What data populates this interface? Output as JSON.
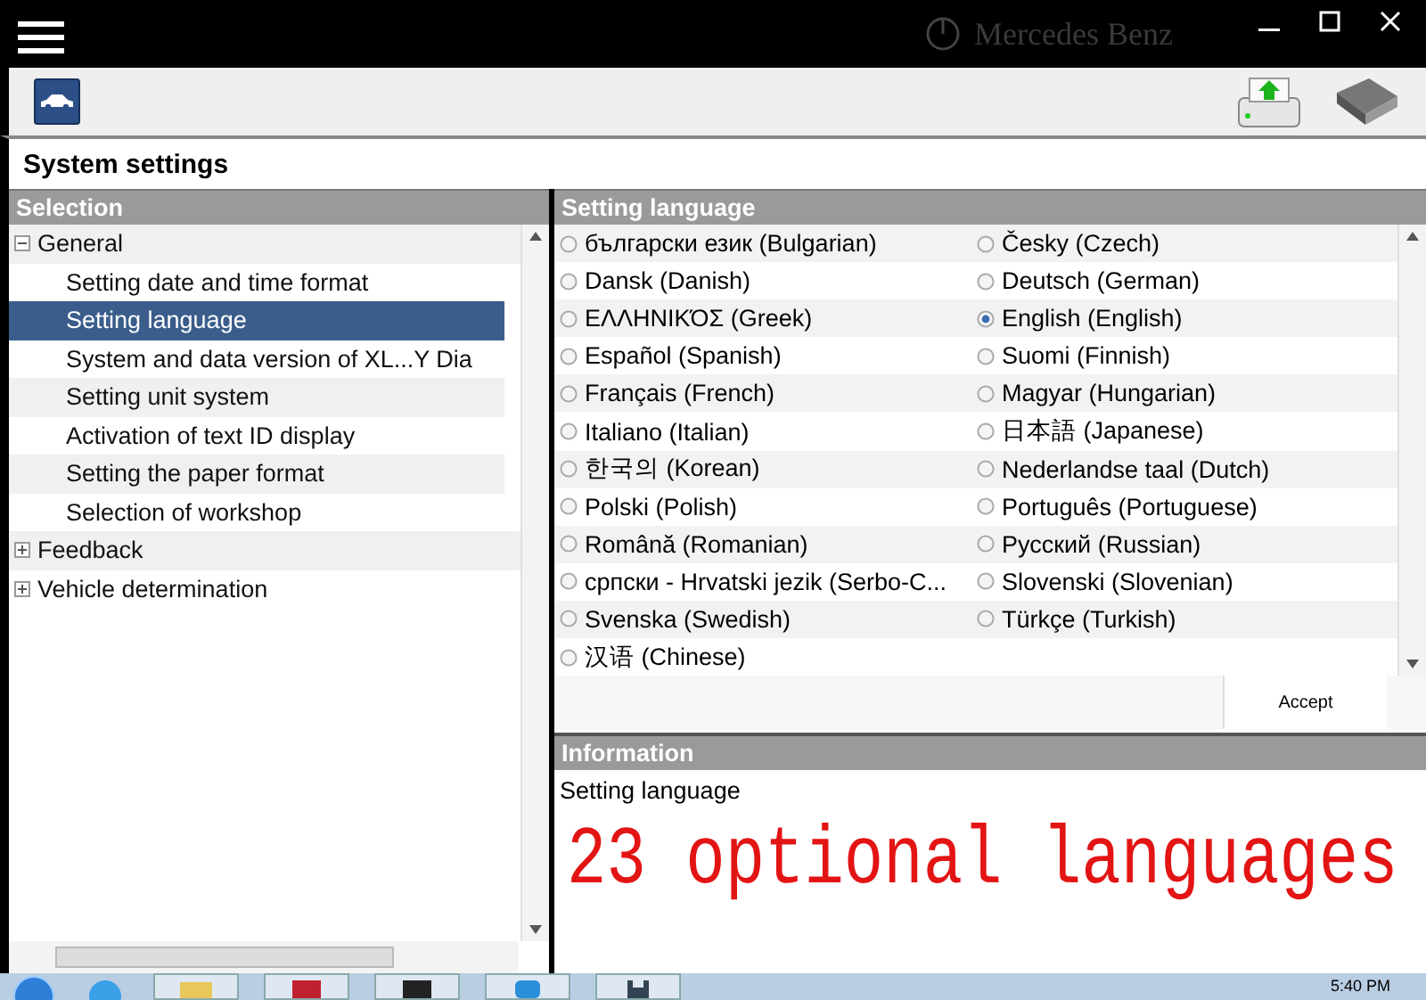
{
  "title_bar": {
    "brand": "Mercedes Benz"
  },
  "page_title": "System settings",
  "selection": {
    "header": "Selection",
    "tree": [
      {
        "label": "General",
        "expanded": true,
        "children": [
          {
            "label": "Setting date and time format",
            "selected": false
          },
          {
            "label": "Setting language",
            "selected": true
          },
          {
            "label": "System and data version of XL...Y Dia",
            "selected": false
          },
          {
            "label": "Setting unit system",
            "selected": false
          },
          {
            "label": "Activation of text ID display",
            "selected": false
          },
          {
            "label": "Setting the paper format",
            "selected": false
          },
          {
            "label": "Selection of workshop",
            "selected": false
          }
        ]
      },
      {
        "label": "Feedback",
        "expanded": false
      },
      {
        "label": "Vehicle determination",
        "expanded": false
      }
    ]
  },
  "language_panel": {
    "header": "Setting language",
    "languages": [
      {
        "label": "български език (Bulgarian)",
        "selected": false
      },
      {
        "label": "Dansk (Danish)",
        "selected": false
      },
      {
        "label": "ΕΛΛΗΝΙΚΌΣ (Greek)",
        "selected": false
      },
      {
        "label": "Español (Spanish)",
        "selected": false
      },
      {
        "label": "Français (French)",
        "selected": false
      },
      {
        "label": "Italiano (Italian)",
        "selected": false
      },
      {
        "label": "한국의 (Korean)",
        "selected": false
      },
      {
        "label": "Polski (Polish)",
        "selected": false
      },
      {
        "label": "Română (Romanian)",
        "selected": false
      },
      {
        "label": "српски - Hrvatski jezik (Serbo-C...",
        "selected": false
      },
      {
        "label": "Svenska (Swedish)",
        "selected": false
      },
      {
        "label": "汉语 (Chinese)",
        "selected": false
      },
      {
        "label": "Česky (Czech)",
        "selected": false
      },
      {
        "label": "Deutsch (German)",
        "selected": false
      },
      {
        "label": "English (English)",
        "selected": true
      },
      {
        "label": "Suomi (Finnish)",
        "selected": false
      },
      {
        "label": "Magyar (Hungarian)",
        "selected": false
      },
      {
        "label": "日本語 (Japanese)",
        "selected": false
      },
      {
        "label": "Nederlandse taal (Dutch)",
        "selected": false
      },
      {
        "label": "Português (Portuguese)",
        "selected": false
      },
      {
        "label": "Русский (Russian)",
        "selected": false
      },
      {
        "label": "Slovenski (Slovenian)",
        "selected": false
      },
      {
        "label": "Türkçe (Turkish)",
        "selected": false
      }
    ],
    "accept_button": "Accept"
  },
  "information": {
    "header": "Information",
    "text": "Setting language",
    "note": "23 optional languages"
  },
  "taskbar": {
    "clock": "5:40 PM"
  }
}
